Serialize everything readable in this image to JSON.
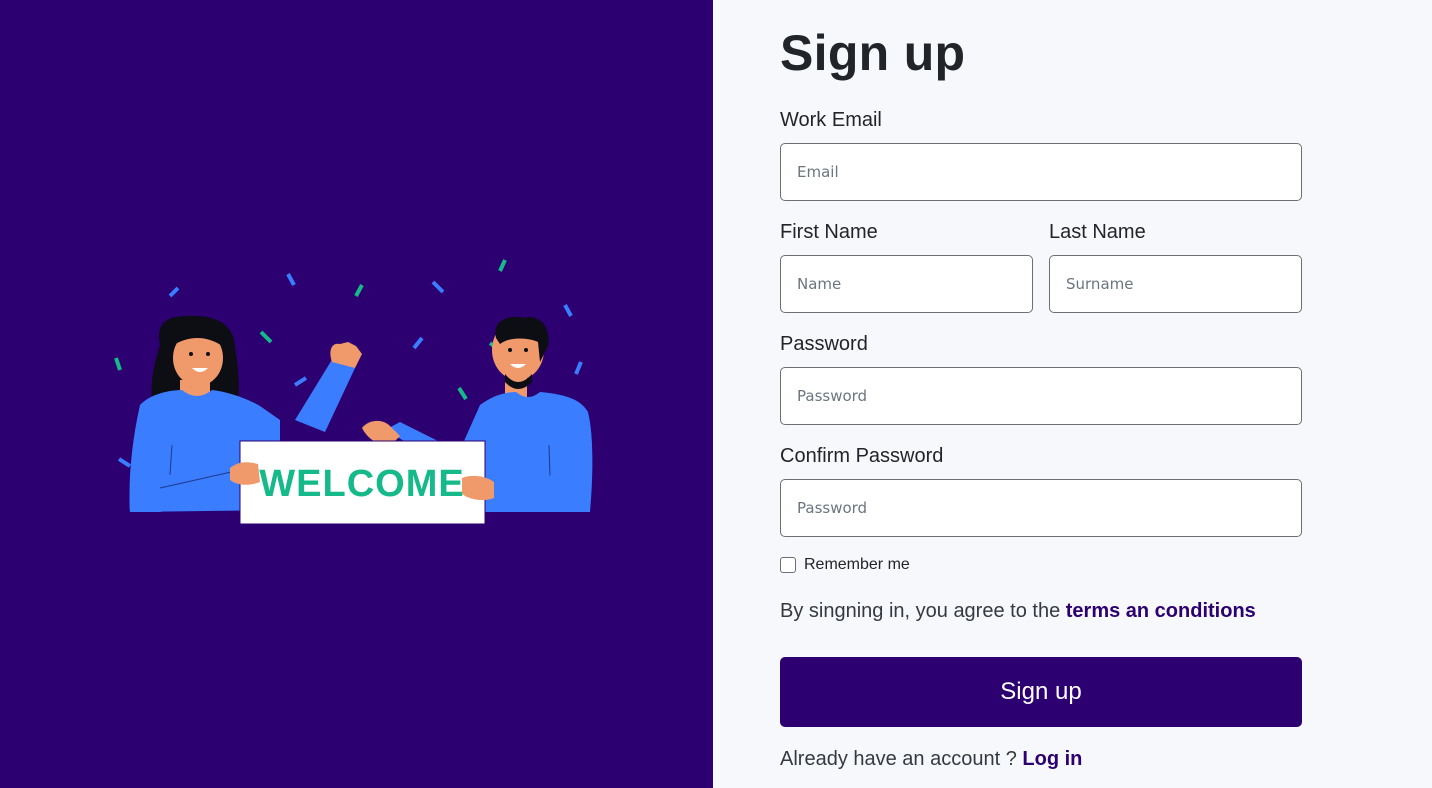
{
  "illustration": {
    "sign_text": "WELCOME",
    "colors": {
      "background": "#2c0070",
      "shirt": "#3a7dff",
      "skin": "#f09a6c",
      "sign_text": "#16b98a",
      "confetti_blue": "#3a7dff",
      "confetti_green": "#16b98a"
    }
  },
  "form": {
    "title": "Sign up",
    "email": {
      "label": "Work Email",
      "placeholder": "Email"
    },
    "first_name": {
      "label": "First Name",
      "placeholder": "Name"
    },
    "last_name": {
      "label": "Last Name",
      "placeholder": "Surname"
    },
    "password": {
      "label": "Password",
      "placeholder": "Password"
    },
    "confirm_password": {
      "label": "Confirm Password",
      "placeholder": "Password"
    },
    "remember_me": {
      "label": "Remember me",
      "checked": false
    },
    "terms": {
      "text": "By singning in, you agree to the ",
      "link": "terms an conditions"
    },
    "submit_label": "Sign up",
    "login": {
      "text": "Already have an account ? ",
      "link": "Log in"
    }
  },
  "colors": {
    "brand": "#2c0070",
    "page_background": "#f7f8fc",
    "input_border": "#6c6f73"
  }
}
